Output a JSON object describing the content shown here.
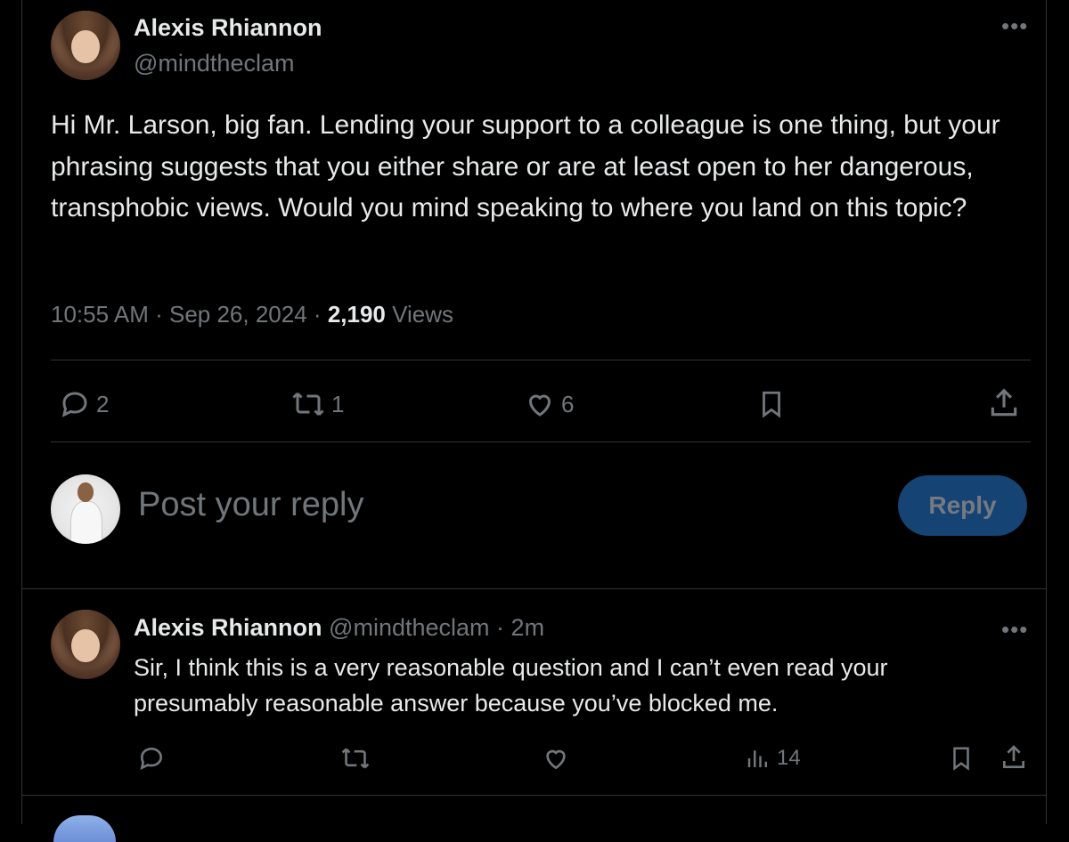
{
  "post": {
    "author_name": "Alexis Rhiannon",
    "author_handle": "@mindtheclam",
    "text": "Hi Mr. Larson, big fan. Lending your support to a colleague is one thing, but your phrasing suggests that you either share or are at least open to her dangerous, transphobic views. Would you mind speaking to where you land on this topic?",
    "time": "10:55 AM",
    "date": "Sep 26, 2024",
    "views_count": "2,190",
    "views_label": "Views",
    "more_label": "•••",
    "actions": {
      "reply_count": "2",
      "repost_count": "1",
      "like_count": "6"
    }
  },
  "composer": {
    "placeholder": "Post your reply",
    "button_label": "Reply"
  },
  "reply": {
    "author_name": "Alexis Rhiannon",
    "author_handle": "@mindtheclam",
    "age": "2m",
    "text": "Sir, I think this is a very reasonable question and I can’t even read your presumably reasonable answer because you’ve blocked me.",
    "more_label": "•••",
    "views_count": "14"
  },
  "icons": [
    "reply-icon",
    "repost-icon",
    "like-icon",
    "bookmark-icon",
    "share-icon",
    "views-icon",
    "more-icon"
  ],
  "colors": {
    "background": "#000000",
    "text": "#e7e9ea",
    "muted": "#71767b",
    "divider": "#2f3336",
    "reply_button": "#1d5a9a"
  }
}
